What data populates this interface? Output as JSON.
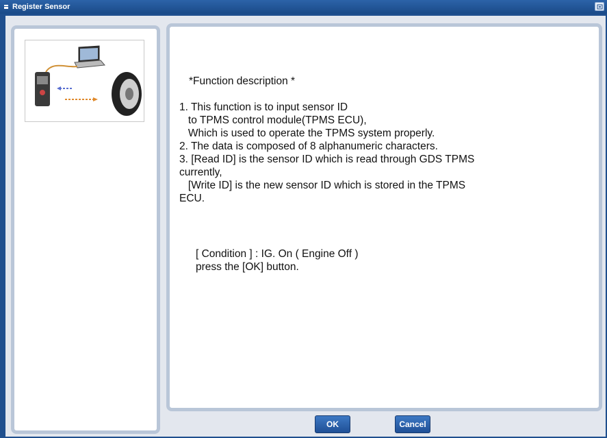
{
  "window": {
    "title": "Register Sensor"
  },
  "description": {
    "heading": "*Function description *",
    "lines": [
      "1. This function is to input sensor ID",
      "   to TPMS control module(TPMS ECU),",
      "   Which is used to operate the TPMS system properly.",
      "2. The data is composed of 8 alphanumeric characters.",
      "3. [Read ID] is the sensor ID which is read through GDS TPMS",
      "currently,",
      "   [Write ID] is the new sensor ID which is stored in the TPMS",
      "ECU."
    ],
    "condition": "[ Condition ] : IG. On ( Engine Off )",
    "instruction": "press the [OK] button."
  },
  "buttons": {
    "ok": "OK",
    "cancel": "Cancel"
  },
  "icons": {
    "title": "window-icon",
    "close": "close-icon",
    "illustration": "tpms-connection-illustration"
  },
  "colors": {
    "titlebar": "#1f4f8e",
    "panel_border": "#b9c6d8",
    "button": "#2a62ad"
  }
}
